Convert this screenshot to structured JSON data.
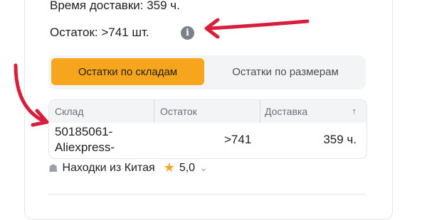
{
  "product": {
    "delivery_line": "Время доставки: 359 ч.",
    "stock_line": "Остаток: >741 шт.",
    "info_icon": "i"
  },
  "tabs": {
    "active": "Остатки по складам",
    "inactive": "Остатки по размерам"
  },
  "table": {
    "headers": {
      "warehouse": "Склад",
      "stock": "Остаток",
      "delivery": "Доставка"
    },
    "sort_icon": "↑",
    "rows": [
      {
        "warehouse": "50185061-\nAliexpress-",
        "stock": ">741",
        "delivery": "359 ч."
      }
    ]
  },
  "seller": {
    "shop_icon": "☗",
    "name": "Находки из Китая",
    "star_icon": "★",
    "rating": "5,0",
    "chevron_icon": "⌄"
  },
  "colors": {
    "accent": "#f7a51c",
    "annotation_arrow": "#d81e3a"
  }
}
